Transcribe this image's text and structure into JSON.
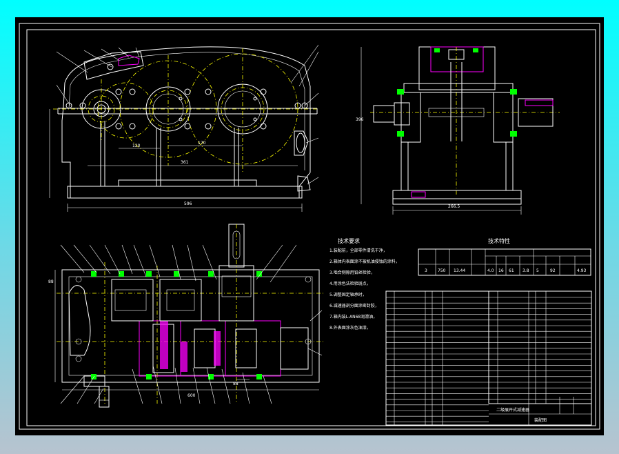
{
  "colors": {
    "outer_top": "#00ffff",
    "outer_bottom": "#b7c3cf",
    "canvas": "#000000",
    "line_main": "#ffffff",
    "line_center": "#ffff00",
    "line_magenta": "#ff00ff",
    "line_green": "#00ff00",
    "line_cyan": "#00ffff",
    "line_red": "#ff3030"
  },
  "notes": {
    "heading": "技术要求",
    "lines": [
      "1.装配前，全部零件清洗干净，",
      "2.箱体内表面涂不被机油侵蚀的涂料，",
      "3.啮合侧隙用铅丝检验，",
      "4.用涂色法检验斑点，",
      "5.调整固定轴承时，",
      "6.减速器剖分面涂密封胶，",
      "7.箱内装L-AN68润滑油，",
      "8.外表面涂灰色油漆。"
    ]
  },
  "spec": {
    "heading": "技术特性",
    "row": [
      "3",
      "750",
      "13.44",
      "4.0",
      "16",
      "61",
      "3.8",
      "5",
      "92",
      "4.93"
    ]
  },
  "title_block": {
    "name": "二级展开式减速器",
    "label": "装配图"
  },
  "dims": {
    "front_width": "596",
    "front_center1": "120",
    "front_center2": "170",
    "front_height": "361",
    "side_width": "266.5",
    "side_height": "396",
    "top_width": "600",
    "top_shaft": "88"
  }
}
